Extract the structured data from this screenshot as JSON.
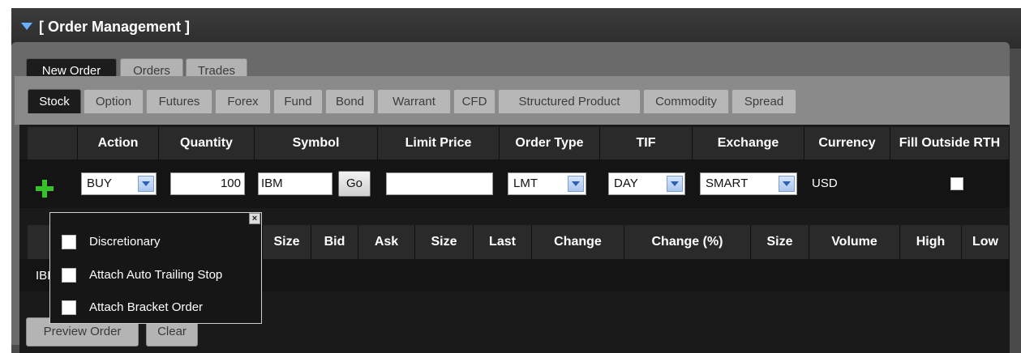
{
  "window": {
    "title": "[ Order Management ]"
  },
  "main_tabs": [
    {
      "label": "New Order",
      "active": true
    },
    {
      "label": "Orders",
      "active": false
    },
    {
      "label": "Trades",
      "active": false
    }
  ],
  "instrument_tabs": [
    {
      "label": "Stock",
      "active": true
    },
    {
      "label": "Option"
    },
    {
      "label": "Futures"
    },
    {
      "label": "Forex"
    },
    {
      "label": "Fund"
    },
    {
      "label": "Bond"
    },
    {
      "label": "Warrant"
    },
    {
      "label": "CFD"
    },
    {
      "label": "Structured Product"
    },
    {
      "label": "Commodity"
    },
    {
      "label": "Spread"
    }
  ],
  "order_columns": [
    "Action",
    "Quantity",
    "Symbol",
    "Limit Price",
    "Order Type",
    "TIF",
    "Exchange",
    "Currency",
    "Fill Outside RTH"
  ],
  "order_row": {
    "action": "BUY",
    "quantity": "100",
    "symbol": "IBM",
    "go_label": "Go",
    "limit_price": "",
    "order_type": "LMT",
    "tif": "DAY",
    "exchange": "SMART",
    "currency": "USD",
    "fill_outside_rth": false
  },
  "quote_columns": [
    "Size",
    "Bid",
    "Ask",
    "Size",
    "Last",
    "Change",
    "Change (%)",
    "Size",
    "Volume",
    "High",
    "Low"
  ],
  "quote_row": {
    "symbol_partial": "IBI"
  },
  "popup": {
    "items": [
      {
        "label": "Discretionary",
        "checked": false
      },
      {
        "label": "Attach Auto Trailing Stop",
        "checked": false
      },
      {
        "label": "Attach Bracket Order",
        "checked": false
      }
    ],
    "close_label": "×"
  },
  "buttons": {
    "preview": "Preview Order",
    "clear": "Clear"
  },
  "colors": {
    "accent_plus": "#36c02a",
    "header_bg": "#2a2a2a",
    "dropdown_arrow": "#3060b0"
  }
}
